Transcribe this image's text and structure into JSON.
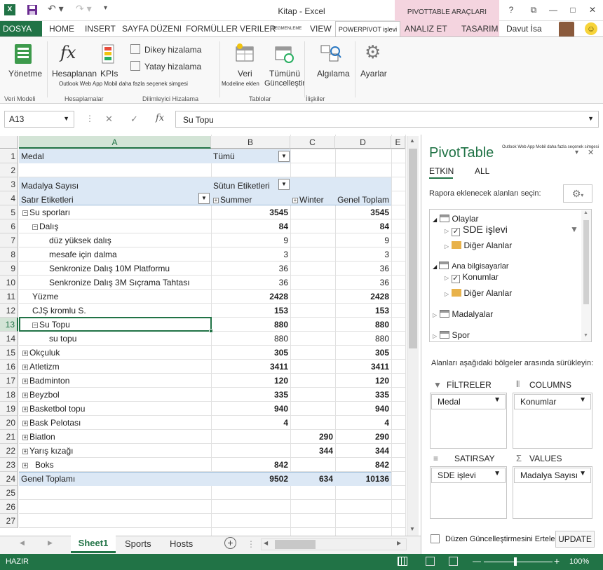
{
  "window": {
    "title": "Kitap - Excel",
    "context_group": "PIVOTTABLE ARAÇLARI",
    "help": "?",
    "restore": "⧉",
    "minimize": "—",
    "maximize": "□",
    "close": "✕"
  },
  "tabs": {
    "file": "DOSYA",
    "home": "HOME",
    "insert": "INSERT",
    "page_layout": "SAYFA DÜZENI",
    "formulas": "FORMÜLLER",
    "data": "VERILER",
    "review": "SEGMENLEME",
    "view": "VIEW",
    "powerpivot": "POWERPIVOT işlevi",
    "analyze": "ANALIZ ET",
    "design": "TASARIM",
    "user": "Davut İsa"
  },
  "ribbon": {
    "manage": "Yönetme",
    "measures": "Hesaplanan",
    "kpis": "KPIs",
    "measures_sub": "Outlook Web App Mobil daha fazla seçenek simgesi",
    "vertical": "Dikey hizalama",
    "horizontal": "Yatay hizalama",
    "add_data": "Veri",
    "add_data_sub": "Modeline eklen",
    "update_all": "Tümünü",
    "update_all_sub": "Güncelleştir",
    "detect": "Algılama",
    "settings": "Ayarlar",
    "g_model": "Veri Modeli",
    "g_calc": "Hesaplamalar",
    "g_slicer": "Dilimleyici Hizalama",
    "g_tables": "Tablolar",
    "g_rel": "İlişkiler"
  },
  "formula_bar": {
    "name_box": "A13",
    "cancel": "✕",
    "enter": "✓",
    "fx": "fx",
    "content": "Su Topu"
  },
  "columns": [
    "A",
    "B",
    "C",
    "D",
    "E"
  ],
  "rows": {
    "r1": {
      "a": "Medal",
      "b": "Tümü"
    },
    "r3": {
      "a": "Madalya Sayısı",
      "b": "Sütun Etiketleri"
    },
    "r4": {
      "a": "Satır Etiketleri",
      "b": "Summer",
      "c": "Winter",
      "d": "Genel Toplam"
    },
    "r5": {
      "a": "Su sporları",
      "b": "3545",
      "d": "3545"
    },
    "r6": {
      "a": "Dalış",
      "b": "84",
      "d": "84"
    },
    "r7": {
      "a": "düz yüksek dalış",
      "b": "9",
      "d": "9"
    },
    "r8": {
      "a": "mesafe için dalma",
      "b": "3",
      "d": "3"
    },
    "r9": {
      "a": "Senkronize Dalış 10M Platformu",
      "b": "36",
      "d": "36"
    },
    "r10": {
      "a": "Senkronize Dalış 3M Sıçrama Tahtası",
      "b": "36",
      "d": "36"
    },
    "r11": {
      "a": "Yüzme",
      "b": "2428",
      "d": "2428"
    },
    "r12": {
      "a": "CJŞ kromlu S.",
      "b": "153",
      "d": "153"
    },
    "r13": {
      "a": "Su Topu",
      "b": "880",
      "d": "880"
    },
    "r14": {
      "a": "su topu",
      "b": "880",
      "d": "880"
    },
    "r15": {
      "a": "Okçuluk",
      "b": "305",
      "d": "305"
    },
    "r16": {
      "a": "Atletizm",
      "b": "3411",
      "d": "3411"
    },
    "r17": {
      "a": "Badminton",
      "b": "120",
      "d": "120"
    },
    "r18": {
      "a": "Beyzbol",
      "b": "335",
      "d": "335"
    },
    "r19": {
      "a": "Basketbol topu",
      "b": "940",
      "d": "940"
    },
    "r20": {
      "a": "Bask Pelotası",
      "b": "4",
      "d": "4"
    },
    "r21": {
      "a": "Biatlon",
      "c": "290",
      "d": "290"
    },
    "r22": {
      "a": "Yarış kızağı",
      "c": "344",
      "d": "344"
    },
    "r23": {
      "a": "Boks",
      "b": "842",
      "d": "842"
    },
    "r24": {
      "a": "Genel Toplamı",
      "b": "9502",
      "c": "634",
      "d": "10136"
    }
  },
  "row_numbers": [
    "1",
    "2",
    "3",
    "4",
    "5",
    "6",
    "7",
    "8",
    "9",
    "10",
    "11",
    "12",
    "13",
    "14",
    "15",
    "16",
    "17",
    "18",
    "19",
    "20",
    "21",
    "22",
    "23",
    "24",
    "25",
    "26",
    "27"
  ],
  "sheets": {
    "active": "Sheet1",
    "s2": "Sports",
    "s3": "Hosts",
    "add": "+"
  },
  "status": {
    "ready": "HAZIR",
    "zoom": "100%",
    "minus": "—",
    "plus": "+"
  },
  "pane": {
    "title": "PivotTable",
    "title_sub": "Outlook Web App Mobil daha fazla seçenek simgesi",
    "tab_active": "ETKIN",
    "tab_all": "ALL",
    "choose": "Rapora eklenecek alanları seçin:",
    "olaylar": "Olaylar",
    "sde": "SDE işlevi",
    "diger1": "Diğer Alanlar",
    "host": "Ana bilgisayarlar",
    "konumlar": "Konumlar",
    "diger2": "Diğer Alanlar",
    "madalyalar": "Madalyalar",
    "spor": "Spor",
    "drag": "Alanları aşağıdaki bölgeler arasında sürükleyin:",
    "filters": "FİLTRELER",
    "columns": "COLUMNS",
    "rows": "SATIRSAY",
    "values": "VALUES",
    "filters_item": "Medal",
    "columns_item": "Konumlar",
    "rows_item": "SDE işlevi",
    "values_item": "Madalya Sayısı",
    "defer": "Düzen Güncelleştirmesini Ertele",
    "update": "UPDATE"
  }
}
